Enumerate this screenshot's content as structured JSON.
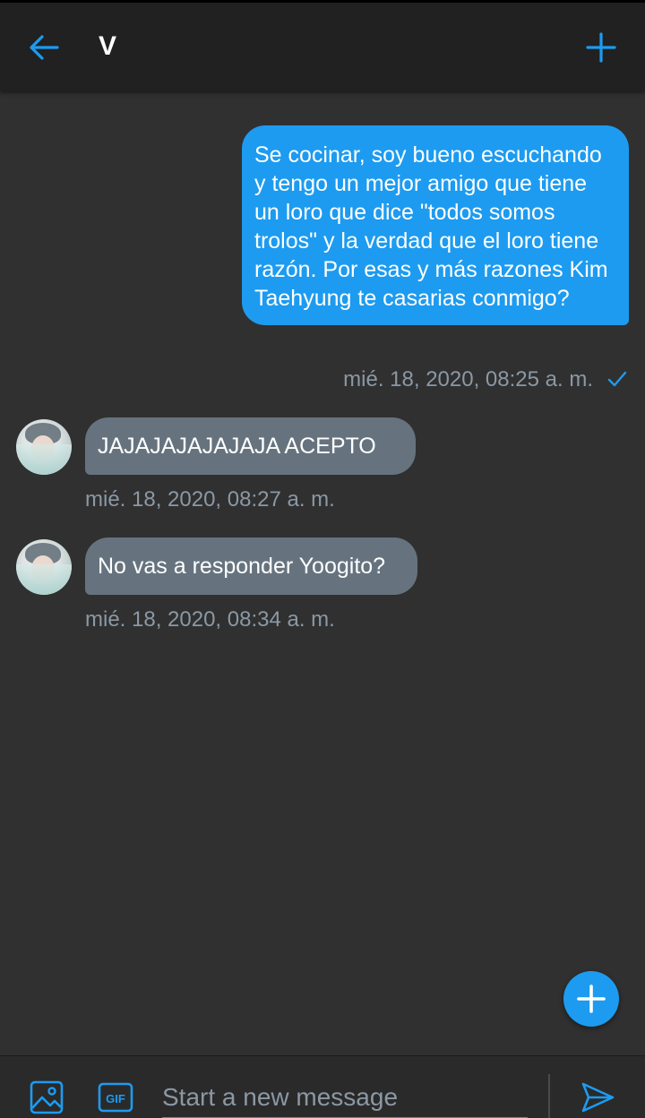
{
  "colors": {
    "accent": "#1d9bf0",
    "background": "#303030",
    "header": "#212121",
    "received_bubble": "#66737f",
    "timestamp": "#8b98a5"
  },
  "header": {
    "title": "V",
    "back_icon": "arrow-left-icon",
    "add_icon": "plus-icon"
  },
  "messages": [
    {
      "direction": "sent",
      "text": "Se cocinar, soy bueno escuchando y tengo un mejor amigo que tiene un loro que dice \"todos somos trolos\" y la verdad que el loro tiene razón. Por esas y más razones Kim Taehyung te casarias conmigo?",
      "timestamp": "mié. 18, 2020, 08:25 a. m.",
      "status_icon": "check-icon"
    },
    {
      "direction": "received",
      "text": "JAJAJAJAJAJAJA ACEPTO",
      "timestamp": "mié. 18, 2020, 08:27 a. m."
    },
    {
      "direction": "received",
      "text": "No vas a responder Yoogito?",
      "timestamp": "mié. 18, 2020, 08:34 a. m."
    }
  ],
  "fab": {
    "icon": "plus-icon"
  },
  "composer": {
    "image_icon": "image-icon",
    "gif_label": "GIF",
    "placeholder": "Start a new message",
    "value": "",
    "send_icon": "send-icon"
  }
}
